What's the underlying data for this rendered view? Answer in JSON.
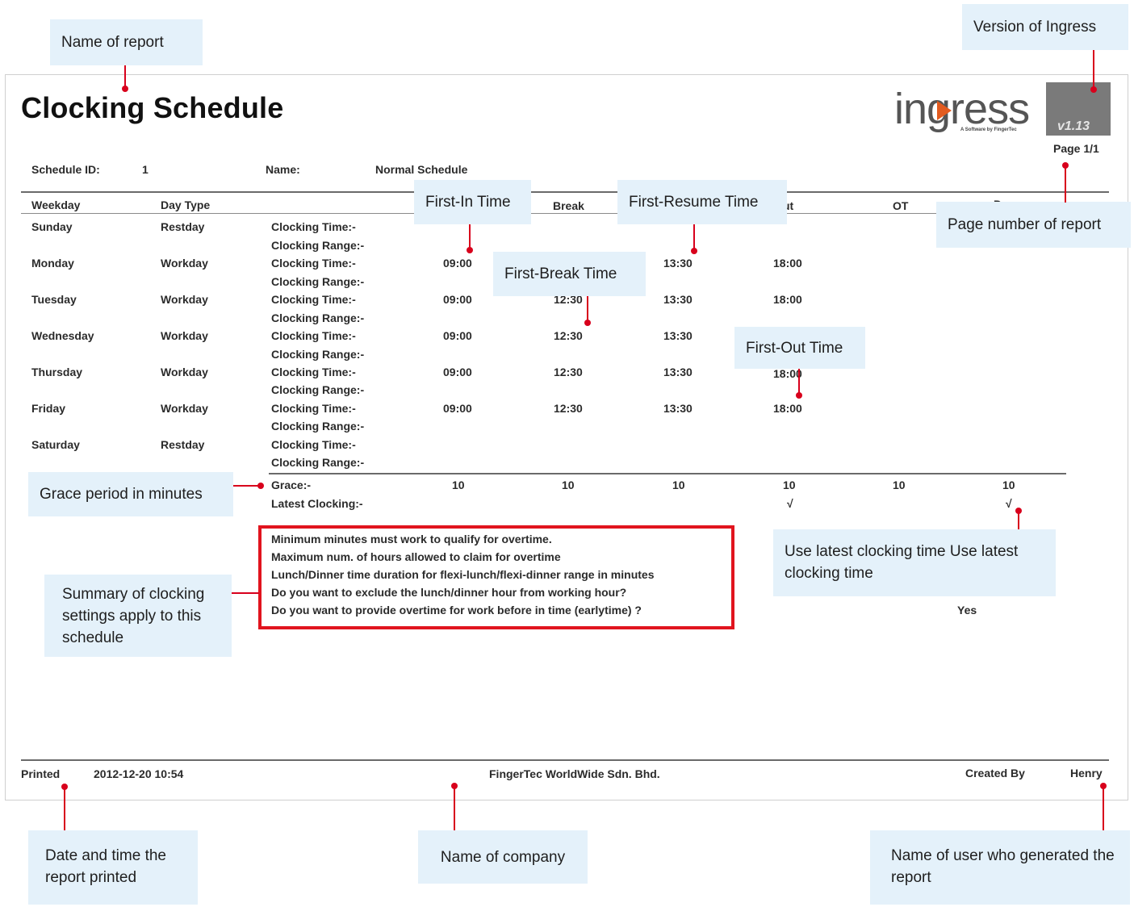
{
  "report": {
    "title": "Clocking Schedule",
    "logo": "ingress",
    "logo_sub": "A Software by FingerTec",
    "version": "v1.13",
    "page": "Page 1/1",
    "schedule_id_label": "Schedule ID:",
    "schedule_id": "1",
    "name_label": "Name:",
    "name": "Normal Schedule",
    "headers": {
      "weekday": "Weekday",
      "day_type": "Day Type",
      "break": "Break",
      "out_partial": "ut",
      "ot": "OT",
      "done_partial": "Done"
    },
    "rows": [
      {
        "weekday": "Sunday",
        "type": "Restday",
        "l1": "Clocking Time:-",
        "l2": "Clocking Range:-",
        "in": "",
        "brk": "",
        "resume": "",
        "out": ""
      },
      {
        "weekday": "Monday",
        "type": "Workday",
        "l1": "Clocking Time:-",
        "l2": "Clocking Range:-",
        "in": "09:00",
        "brk": "",
        "resume": "13:30",
        "out": "18:00"
      },
      {
        "weekday": "Tuesday",
        "type": "Workday",
        "l1": "Clocking Time:-",
        "l2": "Clocking Range:-",
        "in": "09:00",
        "brk": "12:30",
        "resume": "13:30",
        "out": "18:00"
      },
      {
        "weekday": "Wednesday",
        "type": "Workday",
        "l1": "Clocking Time:-",
        "l2": "Clocking Range:-",
        "in": "09:00",
        "brk": "12:30",
        "resume": "13:30",
        "out": ""
      },
      {
        "weekday": "Thursday",
        "type": "Workday",
        "l1": "Clocking Time:-",
        "l2": "Clocking Range:-",
        "in": "09:00",
        "brk": "12:30",
        "resume": "13:30",
        "out": "18:00"
      },
      {
        "weekday": "Friday",
        "type": "Workday",
        "l1": "Clocking Time:-",
        "l2": "Clocking Range:-",
        "in": "09:00",
        "brk": "12:30",
        "resume": "13:30",
        "out": "18:00"
      },
      {
        "weekday": "Saturday",
        "type": "Restday",
        "l1": "Clocking Time:-",
        "l2": "Clocking Range:-",
        "in": "",
        "brk": "",
        "resume": "",
        "out": ""
      }
    ],
    "grace_label": "Grace:-",
    "grace_values": [
      "10",
      "10",
      "10",
      "10",
      "10",
      "10"
    ],
    "latest_label": "Latest Clocking:-",
    "latest_marks": [
      "√",
      "√"
    ],
    "summary": [
      "Minimum minutes must work to qualify for overtime.",
      "Maximum num. of hours allowed to claim for overtime",
      "Lunch/Dinner time duration for flexi-lunch/flexi-dinner range in minutes",
      "Do you want to exclude the lunch/dinner hour from working hour?",
      "Do you want to provide overtime for work before in time (earlytime) ?"
    ],
    "summary_answer": "Yes",
    "footer": {
      "printed_label": "Printed",
      "printed_value": "2012-12-20 10:54",
      "company": "FingerTec WorldWide Sdn. Bhd.",
      "created_label": "Created By",
      "created_value": "Henry"
    }
  },
  "callouts": {
    "name_of_report": "Name of report",
    "version": "Version of Ingress",
    "first_in": "First-In Time",
    "first_resume": "First-Resume Time",
    "page_number": "Page number of report",
    "first_break": "First-Break Time",
    "first_out": "First-Out Time",
    "grace": "Grace period in minutes",
    "latest": "Use latest clocking time Use latest clocking time",
    "summary": "Summary of clocking settings apply to this schedule",
    "printed": "Date and time the report printed",
    "company": "Name of company",
    "user": "Name of user who generated the report"
  },
  "colors": {
    "callout_bg": "#e4f1fa",
    "accent_red": "#d8001c",
    "box_red": "#e1141e"
  }
}
